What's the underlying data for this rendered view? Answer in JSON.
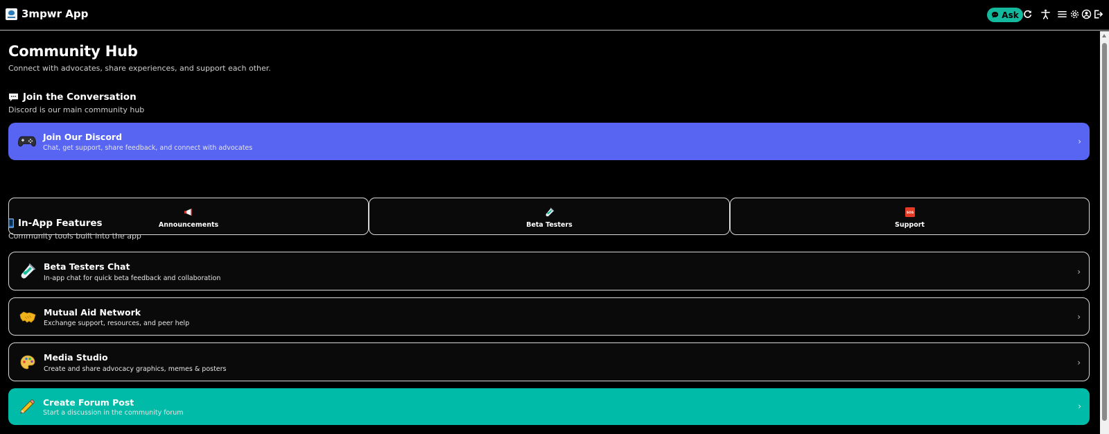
{
  "app": {
    "title": "3mpwr App"
  },
  "toolbar": {
    "ask_label": "Ask"
  },
  "page": {
    "title": "Community Hub",
    "subtitle": "Connect with advocates, share experiences, and support each other."
  },
  "conversation": {
    "title": "Join the Conversation",
    "subtitle": "Discord is our main community hub",
    "discord": {
      "title": "Join Our Discord",
      "description": "Chat, get support, share feedback, and connect with advocates"
    },
    "channels": [
      {
        "label": "Announcements",
        "icon": "megaphone-icon"
      },
      {
        "label": "Beta Testers",
        "icon": "test-tube-icon"
      },
      {
        "label": "Support",
        "icon": "sos-icon"
      }
    ]
  },
  "features": {
    "title": "In-App Features",
    "subtitle": "Community tools built into the app",
    "items": [
      {
        "title": "Beta Testers Chat",
        "description": "In-app chat for quick beta feedback and collaboration",
        "icon": "test-tube-icon"
      },
      {
        "title": "Mutual Aid Network",
        "description": "Exchange support, resources, and peer help",
        "icon": "handshake-icon"
      },
      {
        "title": "Media Studio",
        "description": "Create and share advocacy graphics, memes & posters",
        "icon": "palette-icon"
      }
    ],
    "forum": {
      "title": "Create Forum Post",
      "description": "Start a discussion in the community forum",
      "icon": "pencil-icon"
    }
  },
  "colors": {
    "accent": "#00bba7",
    "discord": "#5865f2",
    "background": "#000000"
  }
}
